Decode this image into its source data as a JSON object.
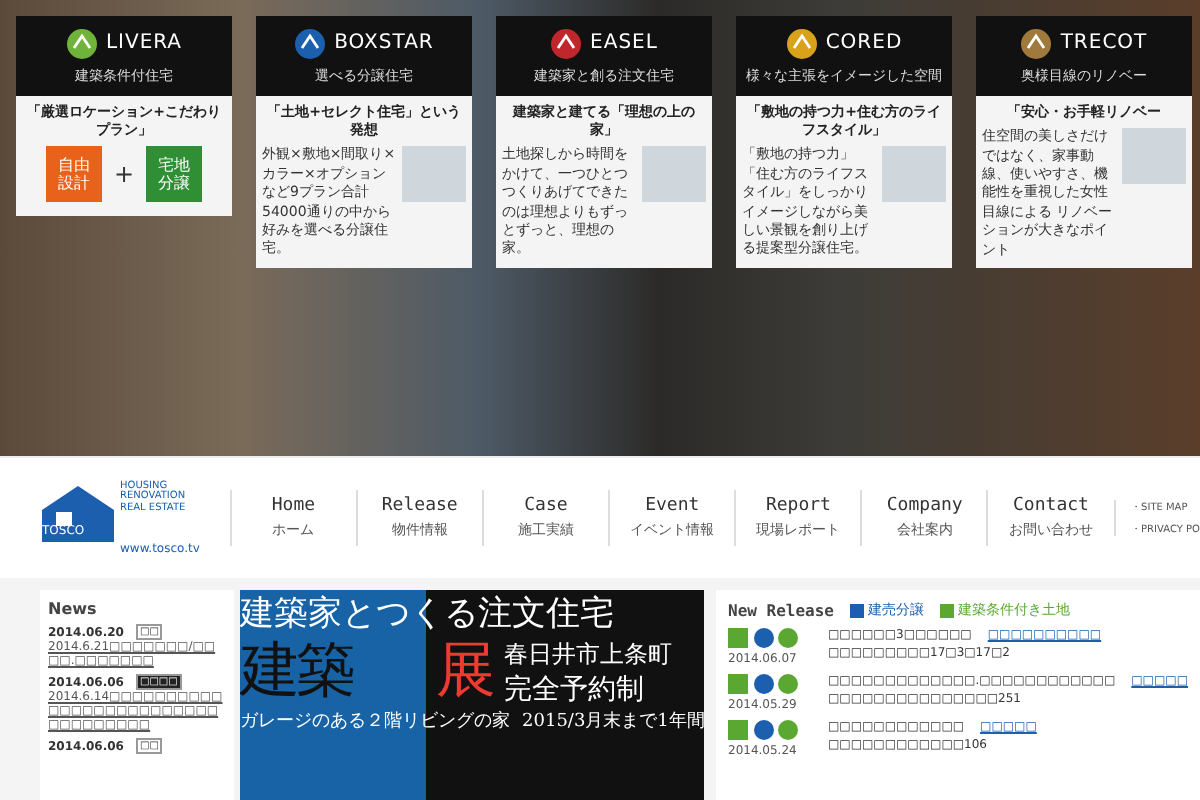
{
  "brands": [
    {
      "kind": "livera",
      "name": "LIVERA",
      "tagline": "建築条件付住宅",
      "headline": "「厳選ロケーション+こだわりプラン」",
      "tags": [
        "自由設計",
        "+",
        "宅地分譲"
      ]
    },
    {
      "kind": "boxstar",
      "name": "BOXSTAR",
      "tagline": "選べる分譲住宅",
      "headline": "「土地+セレクト住宅」という発想",
      "body": "外観×敷地×間取り×カラー×オプションなど9プラン合計54000通りの中から好みを選べる分譲住宅。"
    },
    {
      "kind": "easel",
      "name": "EASEL",
      "tagline": "建築家と創る注文住宅",
      "headline": "建築家と建てる「理想の上の家」",
      "body": "土地探しから時間をかけて、一つひとつつくりあげてできたのは理想よりもずっとずっと、理想の家。"
    },
    {
      "kind": "cored",
      "name": "CORED",
      "tagline": "様々な主張をイメージした空間",
      "headline": "「敷地の持つ力+住む方のライフスタイル」",
      "body": "「敷地の持つ力」「住む方のライフスタイル」をしっかりイメージしながら美しい景観を創り上げる提案型分譲住宅。"
    },
    {
      "kind": "trecot",
      "name": "TRECOT",
      "tagline": "奥様目線のリノベー",
      "headline": "「安心・お手軽リノベー",
      "body": "住空間の美しさだけではなく、家事動線、使いやすさ、機能性を重視した女性目線による リノベーションが大きなポイント"
    }
  ],
  "logo": {
    "lines": [
      "HOUSING",
      "RENOVATION",
      "REAL ESTATE"
    ],
    "name": "TOSCO",
    "url": "www.tosco.tv"
  },
  "nav": [
    {
      "en": "Home",
      "ja": "ホーム"
    },
    {
      "en": "Release",
      "ja": "物件情報"
    },
    {
      "en": "Case",
      "ja": "施工実績"
    },
    {
      "en": "Event",
      "ja": "イベント情報"
    },
    {
      "en": "Report",
      "ja": "現場レポート"
    },
    {
      "en": "Company",
      "ja": "会社案内"
    },
    {
      "en": "Contact",
      "ja": "お問い合わせ"
    }
  ],
  "sub_links": [
    "・SITE MAP",
    "・PRIVACY PO"
  ],
  "news": {
    "title": "News",
    "items": [
      {
        "date": "2014.06.20",
        "tag": "□□",
        "dark": false,
        "text": "2014.6.21□□□□□□□/□□□□.□□□□□□□"
      },
      {
        "date": "2014.06.06",
        "tag": "□□□□",
        "dark": true,
        "text": "2014.6.14□□□□□□□□□□□□□□□□□□□□□□□□□□□□□□□□□□"
      },
      {
        "date": "2014.06.06",
        "tag": "□□",
        "dark": false
      }
    ]
  },
  "banner": {
    "line1": "建築家とつくる注文住宅",
    "big1": "建築",
    "big2": "展",
    "place": "春日井市上条町",
    "reserve": "完全予約制",
    "sub": "ガレージのある２階リビングの家",
    "period": "2015/3月末まで1年間"
  },
  "release": {
    "title": "New Release",
    "legend": [
      {
        "kind": "house",
        "label": "建売分譲"
      },
      {
        "kind": "land",
        "label": "建築条件付き土地"
      }
    ],
    "items": [
      {
        "date": "2014.06.07",
        "line1": "□□□□□□3□□□□□□",
        "link": "□□□□□□□□□□",
        "line2": "□□□□□□□□□17□3□17□2"
      },
      {
        "date": "2014.05.29",
        "line1": "□□□□□□□□□□□□□.□□□□□□□□□□□□",
        "link": "□□□□□",
        "line2": "□□□□□□□□□□□□□□□251"
      },
      {
        "date": "2014.05.24",
        "line1": "□□□□□□□□□□□□",
        "link": "□□□□□",
        "line2": "□□□□□□□□□□□□106"
      }
    ]
  }
}
